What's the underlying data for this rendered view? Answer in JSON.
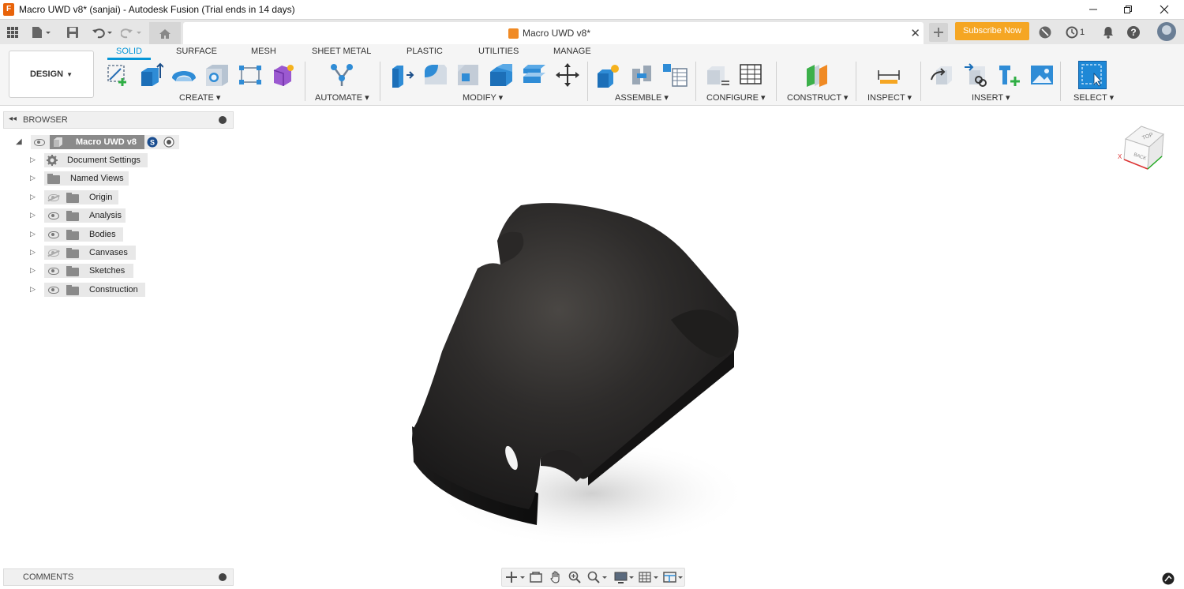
{
  "window": {
    "title": "Macro UWD v8* (sanjai) - Autodesk Fusion (Trial ends in 14 days)",
    "app_logo": "F",
    "controls": [
      "minimize-icon",
      "restore-icon",
      "close-icon"
    ]
  },
  "quick_access": {
    "icons": [
      "grid-icon",
      "file-icon",
      "save-icon",
      "undo-icon",
      "redo-icon",
      "home-icon"
    ],
    "doc_tab": {
      "name": "Macro UWD v8*"
    },
    "subscribe_label": "Subscribe Now",
    "job_count": "1"
  },
  "toolbar": {
    "workspace": "DESIGN",
    "tabs": [
      "SOLID",
      "SURFACE",
      "MESH",
      "SHEET METAL",
      "PLASTIC",
      "UTILITIES",
      "MANAGE"
    ],
    "active_tab": "SOLID",
    "groups": [
      "CREATE",
      "AUTOMATE",
      "MODIFY",
      "ASSEMBLE",
      "CONFIGURE",
      "CONSTRUCT",
      "INSPECT",
      "INSERT",
      "SELECT"
    ],
    "accent_color": "#0696d7"
  },
  "browser": {
    "title": "BROWSER",
    "root": {
      "label": "Macro UWD v8"
    },
    "items": [
      {
        "label": "Document Settings",
        "icon": "gear-icon",
        "visible": null
      },
      {
        "label": "Named Views",
        "icon": "folder-icon",
        "visible": null
      },
      {
        "label": "Origin",
        "icon": "folder-icon",
        "visible": false
      },
      {
        "label": "Analysis",
        "icon": "folder-icon",
        "visible": true
      },
      {
        "label": "Bodies",
        "icon": "folder-icon",
        "visible": true
      },
      {
        "label": "Canvases",
        "icon": "folder-icon",
        "visible": false
      },
      {
        "label": "Sketches",
        "icon": "folder-icon",
        "visible": true
      },
      {
        "label": "Construction",
        "icon": "folder-icon",
        "visible": true
      }
    ]
  },
  "viewcube": {
    "faces": [
      "TOP",
      "BACK"
    ],
    "axis_label": "X"
  },
  "comments": {
    "title": "COMMENTS"
  },
  "subscribe_color": "#f5a623"
}
